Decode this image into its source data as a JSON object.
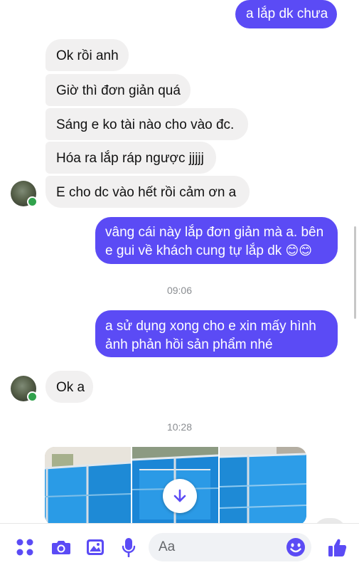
{
  "messages": {
    "m0": "a lắp dk chưa",
    "m1": "Ok rồi anh",
    "m2": "Giờ thì đơn giản quá",
    "m3": "Sáng e ko tài nào cho vào đc.",
    "m4": "Hóa ra lắp ráp ngược jjjjj",
    "m5": "E cho dc vào hết rồi cảm ơn a",
    "m6_line1": "vâng cái này lắp đơn giản mà a. bên",
    "m6_line2": "e gui về khách cung tự lắp dk",
    "m6_emoji": "😊😊",
    "m7_line1": "a sử dụng xong cho e xin mấy hình",
    "m7_line2": "ảnh phản hồi sản phẩm nhé",
    "m8": "Ok a"
  },
  "timestamps": {
    "t1": "09:06",
    "t2": "10:28"
  },
  "composer": {
    "placeholder": "Aa"
  },
  "icons": {
    "apps": "apps-icon",
    "camera": "camera-icon",
    "gallery": "gallery-icon",
    "mic": "microphone-icon",
    "emoji": "emoji-icon",
    "like": "thumbs-up-icon",
    "scroll_down": "arrow-down-icon"
  },
  "colors": {
    "accent": "#5b4bf5",
    "incoming_bubble": "#f1f0f0",
    "online": "#31a24c"
  }
}
